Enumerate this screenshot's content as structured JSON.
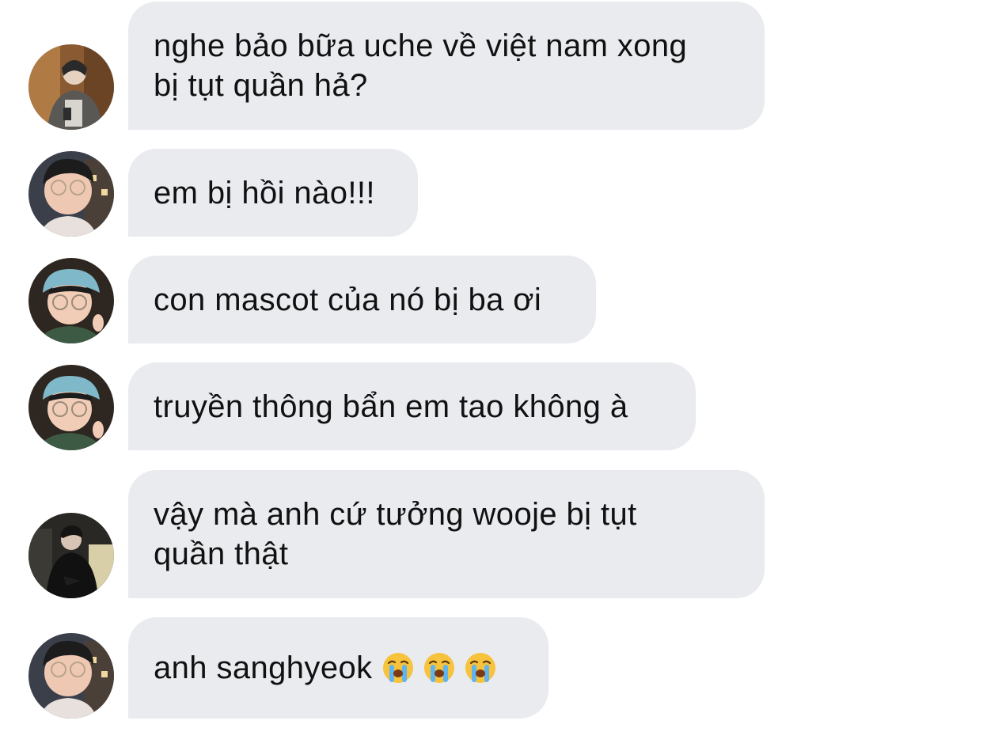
{
  "messages": [
    {
      "avatar": "avatar-photo-1",
      "text": "nghe bảo bữa uche về việt nam xong\nbị tụt quần hả?"
    },
    {
      "avatar": "avatar-photo-2",
      "text": "em bị hồi nào!!!"
    },
    {
      "avatar": "avatar-photo-3",
      "text": "con mascot của nó bị ba ơi"
    },
    {
      "avatar": "avatar-photo-3",
      "text": "truyền thông bẩn em tao không à"
    },
    {
      "avatar": "avatar-photo-4",
      "text": "vậy mà anh cứ tưởng wooje bị tụt\nquần thật"
    },
    {
      "avatar": "avatar-photo-2",
      "text": "anh sanghyeok",
      "emoji": [
        "loudly-crying-face-icon",
        "loudly-crying-face-icon",
        "loudly-crying-face-icon"
      ]
    }
  ],
  "colors": {
    "bubble": "#e9ebef",
    "text": "#111111",
    "background": "#ffffff"
  }
}
